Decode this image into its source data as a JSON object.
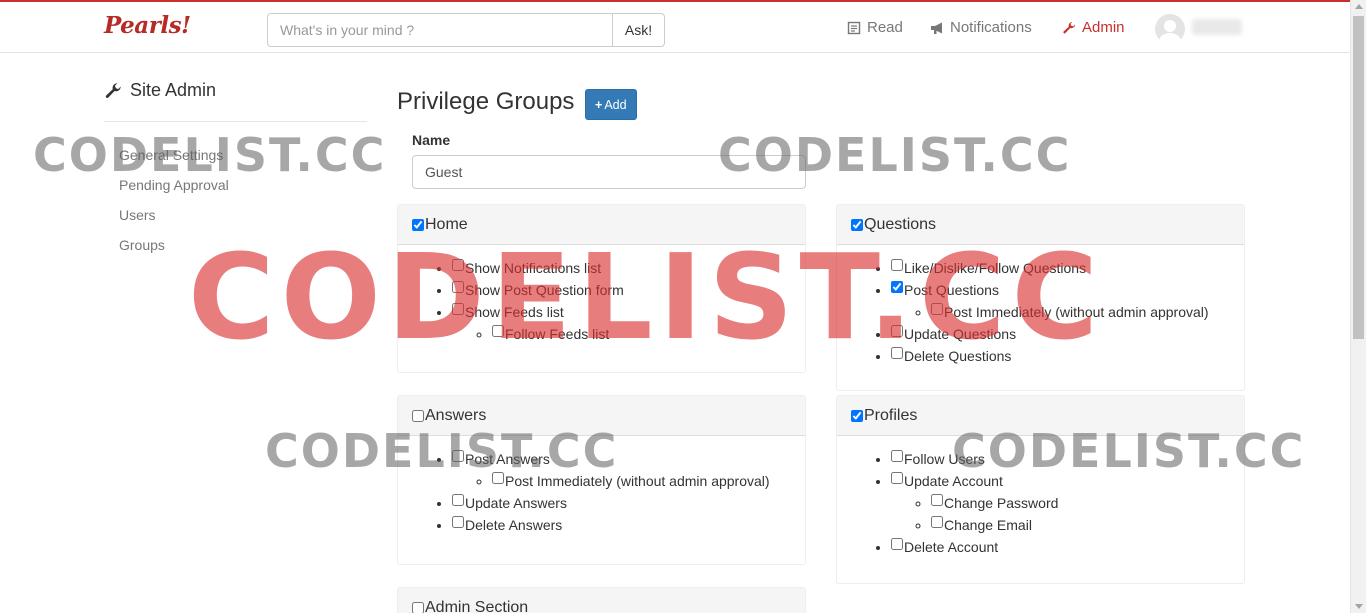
{
  "header": {
    "brand": "Pearls!",
    "search_placeholder": "What's in your mind ?",
    "ask_label": "Ask!",
    "nav": [
      {
        "label": "Read",
        "icon": "book-icon",
        "active": false
      },
      {
        "label": "Notifications",
        "icon": "bullhorn-icon",
        "active": false
      },
      {
        "label": "Admin",
        "icon": "wrench-icon",
        "active": true
      }
    ]
  },
  "sidebar": {
    "title": "Site Admin",
    "items": [
      {
        "label": "General Settings"
      },
      {
        "label": "Pending Approval"
      },
      {
        "label": "Users"
      },
      {
        "label": "Groups"
      }
    ]
  },
  "main": {
    "title": "Privilege Groups",
    "add_label": "Add",
    "name_label": "Name",
    "name_value": "Guest"
  },
  "panels": {
    "home": {
      "title": "Home",
      "checked": true,
      "items": [
        {
          "label": "Show Notifications list",
          "checked": false
        },
        {
          "label": "Show Post Question form",
          "checked": false
        },
        {
          "label": "Show Feeds list",
          "checked": false,
          "children": [
            {
              "label": "Follow Feeds list",
              "checked": false
            }
          ]
        }
      ]
    },
    "questions": {
      "title": "Questions",
      "checked": true,
      "items": [
        {
          "label": "Like/Dislike/Follow Questions",
          "checked": false
        },
        {
          "label": "Post Questions",
          "checked": true,
          "children": [
            {
              "label": "Post Immediately (without admin approval)",
              "checked": false
            }
          ]
        },
        {
          "label": "Update Questions",
          "checked": false
        },
        {
          "label": "Delete Questions",
          "checked": false
        }
      ]
    },
    "answers": {
      "title": "Answers",
      "checked": false,
      "items": [
        {
          "label": "Post Answers",
          "checked": false,
          "children": [
            {
              "label": "Post Immediately (without admin approval)",
              "checked": false
            }
          ]
        },
        {
          "label": "Update Answers",
          "checked": false
        },
        {
          "label": "Delete Answers",
          "checked": false
        }
      ]
    },
    "profiles": {
      "title": "Profiles",
      "checked": true,
      "items": [
        {
          "label": "Follow Users",
          "checked": false
        },
        {
          "label": "Update Account",
          "checked": false,
          "children": [
            {
              "label": "Change Password",
              "checked": false
            },
            {
              "label": "Change Email",
              "checked": false
            }
          ]
        },
        {
          "label": "Delete Account",
          "checked": false
        }
      ]
    },
    "admin": {
      "title": "Admin Section",
      "checked": false,
      "items": []
    }
  },
  "watermark": {
    "text": "CODELIST.CC"
  },
  "colors": {
    "brand": "#b52b27",
    "accent": "#c9302c",
    "primary": "#337ab7"
  }
}
